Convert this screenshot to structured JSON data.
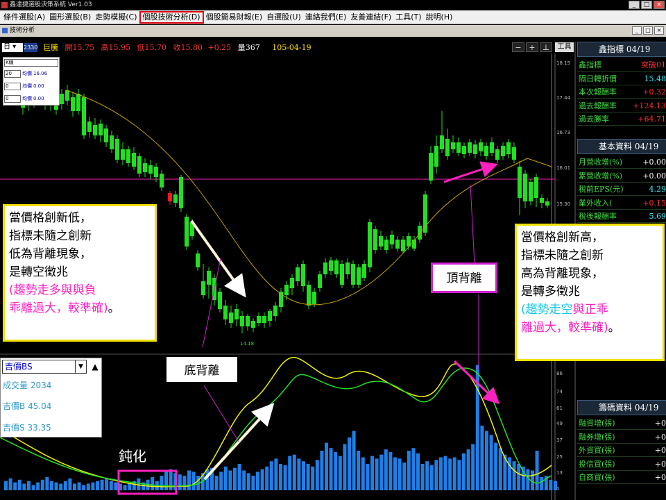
{
  "window": {
    "title": "鑫達捷選股決策系統 Ver1.03",
    "sub_title": "技術分析"
  },
  "menu": [
    "條件選股(A)",
    "圖形選股(B)",
    "走勢模擬(C)",
    "個股技術分析(D)",
    "個股簡易財報(E)",
    "自選股(U)",
    "連絡我們(E)",
    "友善連結(F)",
    "工具(T)",
    "說明(H)"
  ],
  "active_menu_index": 3,
  "toolbar": {
    "period": "日",
    "stock_code": "2330",
    "stock_name": "巨騰",
    "open_label": "開",
    "open": "15.75",
    "high_label": "高",
    "high": "15.95",
    "low_label": "低",
    "low": "15.70",
    "close_label": "收",
    "close": "15.80",
    "change": "+0.25",
    "volume_label": "量",
    "volume": "367",
    "date": "105-04-19",
    "tools_label": "工具"
  },
  "indicator_panel": {
    "type": "K線",
    "rows": [
      {
        "period": "20",
        "label": "均價",
        "value": "16.06"
      },
      {
        "period": "0",
        "label": "均價",
        "value": "0.00"
      },
      {
        "period": "0",
        "label": "均價",
        "value": "0.00"
      }
    ]
  },
  "price_axis": [
    "18.15",
    "17.44",
    "16.73",
    "16.01",
    "15.30"
  ],
  "low_label": "14.18",
  "sub_indicator": {
    "name": "吉價BS",
    "volume_label": "成交量",
    "volume": "2034",
    "b_label": "吉價B",
    "b": "45.04",
    "s_label": "吉價S",
    "s": "33.35"
  },
  "sub_axis": [
    "86",
    "74",
    "61",
    "49",
    "37",
    "25",
    "13",
    "0"
  ],
  "right_panel": {
    "sections": [
      {
        "title": "鑫指標 04/19",
        "rows": [
          {
            "label": "鑫指標",
            "value": "突破01",
            "color": "#ff3030"
          },
          {
            "label": "隔日轉折價",
            "value": "15.48",
            "color": "#39f0ff"
          },
          {
            "label": "本次報酬率",
            "value": "+0.32",
            "color": "#ff3030"
          },
          {
            "label": "過去報酬率",
            "value": "+124.13",
            "color": "#ff3030"
          },
          {
            "label": "過去勝率",
            "value": "+64.71",
            "color": "#ff3030"
          }
        ]
      },
      {
        "title": "基本資料 04/19",
        "rows": [
          {
            "label": "月營收增(%)",
            "value": "+0.00",
            "color": "#ffffff"
          },
          {
            "label": "累營收增(%)",
            "value": "+0.00",
            "color": "#ffffff"
          },
          {
            "label": "稅前EPS(元)",
            "value": "4.29",
            "color": "#39f0ff"
          },
          {
            "label": "業外收入(",
            "value": "+0.15",
            "color": "#ff3030"
          },
          {
            "label": "稅後報酬率",
            "value": "5.69",
            "color": "#39f0ff"
          }
        ]
      },
      {
        "title": "籌碼資料 04/19",
        "rows": [
          {
            "label": "融資增(張)",
            "value": "+0",
            "color": "#ffffff"
          },
          {
            "label": "融券增(張)",
            "value": "+0",
            "color": "#ffffff"
          },
          {
            "label": "外資買(張)",
            "value": "+0",
            "color": "#ffffff"
          },
          {
            "label": "投信買(張)",
            "value": "+0",
            "color": "#ffffff"
          },
          {
            "label": "自商買(張)",
            "value": "+0",
            "color": "#ffffff"
          }
        ]
      }
    ]
  },
  "annotations": {
    "left_box": {
      "lines": [
        "當價格創新低，",
        "指標未隨之創新",
        "低為背離現象，",
        "是轉空徵兆"
      ],
      "note_part1": "(趨勢走多與與負",
      "note_part2": "乖離過大，較準確)",
      "note_end": "。"
    },
    "right_box": {
      "lines": [
        "當價格創新高，",
        "指標未隨之創新",
        "高為背離現象，",
        "是轉多徵兆"
      ],
      "note_part1": "(趨勢走空",
      "note_part2": "與正乖",
      "note_part3": "離過大，較準確)",
      "note_end": "。"
    },
    "bottom_divergence": "底背離",
    "top_divergence": "頂背離",
    "dull": "鈍化"
  },
  "colors": {
    "up": "#ff1a1a",
    "down": "#20e020",
    "ma": "#c8a400",
    "b_line": "#f0f000",
    "s_line": "#20e020",
    "vol": "#1f7fe6",
    "annot_pink": "#ff20c0",
    "annot_cyan": "#18c8e8"
  }
}
